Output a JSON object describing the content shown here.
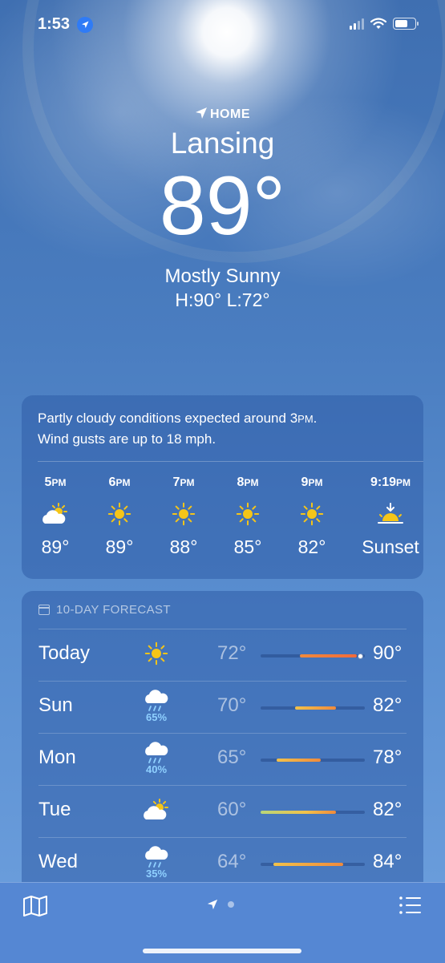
{
  "status": {
    "time": "1:53"
  },
  "location": {
    "label": "HOME",
    "city": "Lansing",
    "temperature": "89°",
    "condition": "Mostly Sunny",
    "hi_lo": "H:90°  L:72°"
  },
  "hourly": {
    "summary_line1_pre": "Partly cloudy conditions expected around 3",
    "summary_line1_unit": "PM",
    "summary_line1_post": ".",
    "summary_line2": "Wind gusts are up to 18 mph.",
    "items": [
      {
        "time": "5",
        "unit": "PM",
        "icon": "partly-cloudy-icon",
        "temp": "89°"
      },
      {
        "time": "6",
        "unit": "PM",
        "icon": "sun-icon",
        "temp": "89°"
      },
      {
        "time": "7",
        "unit": "PM",
        "icon": "sun-icon",
        "temp": "88°"
      },
      {
        "time": "8",
        "unit": "PM",
        "icon": "sun-icon",
        "temp": "85°"
      },
      {
        "time": "9",
        "unit": "PM",
        "icon": "sun-icon",
        "temp": "82°"
      },
      {
        "time": "9:19",
        "unit": "PM",
        "icon": "sunset-icon",
        "temp": "Sunset"
      }
    ]
  },
  "forecast": {
    "title": "10-DAY FORECAST",
    "days": [
      {
        "day": "Today",
        "icon": "sun-icon",
        "precip": "",
        "low": "72°",
        "high": "90°",
        "range_start": 0.38,
        "range_end": 0.92,
        "current": 0.95
      },
      {
        "day": "Sun",
        "icon": "rain-icon",
        "precip": "65%",
        "low": "70°",
        "high": "82°",
        "range_start": 0.33,
        "range_end": 0.72
      },
      {
        "day": "Mon",
        "icon": "rain-icon",
        "precip": "40%",
        "low": "65°",
        "high": "78°",
        "range_start": 0.15,
        "range_end": 0.58
      },
      {
        "day": "Tue",
        "icon": "partly-cloudy-icon",
        "precip": "",
        "low": "60°",
        "high": "82°",
        "range_start": 0.0,
        "range_end": 0.72
      },
      {
        "day": "Wed",
        "icon": "rain-icon",
        "precip": "35%",
        "low": "64°",
        "high": "84°",
        "range_start": 0.12,
        "range_end": 0.79
      }
    ]
  },
  "colors": {
    "accent": "#2f7bf6",
    "sun": "#f5c518",
    "bar_warm": "#f08a3c",
    "bar_mild": "#f2c24a",
    "bar_cool": "#b7d67a"
  }
}
